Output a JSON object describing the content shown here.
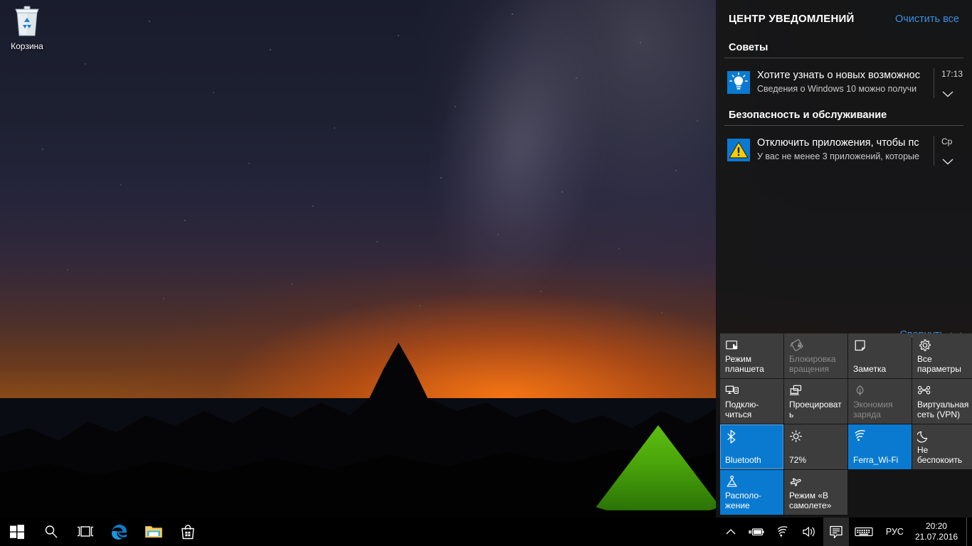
{
  "desktop": {
    "icon": {
      "name": "recycle-bin",
      "label": "Корзина"
    }
  },
  "action_center": {
    "title": "ЦЕНТР УВЕДОМЛЕНИЙ",
    "clear_all": "Очистить все",
    "collapse": "Свернуть",
    "accent_color": "#0a7ad1",
    "link_color": "#3b8ee0",
    "sections": [
      {
        "title": "Советы",
        "notifications": [
          {
            "icon": "lightbulb-icon",
            "icon_color": "#0a7ad1",
            "title": "Хотите узнать о новых возможнос",
            "subtitle": "Сведения о Windows 10 можно получи",
            "time": "17:13"
          }
        ]
      },
      {
        "title": "Безопасность и обслуживание",
        "notifications": [
          {
            "icon": "warning-icon",
            "icon_color": "#0a7ad1",
            "title": "Отключить приложения, чтобы пс",
            "subtitle": "У вас не менее 3 приложений, которые",
            "time": "Ср"
          }
        ]
      }
    ],
    "tiles": [
      {
        "icon": "tablet-mode-icon",
        "label": "Режим планшета",
        "state": "off"
      },
      {
        "icon": "rotation-lock-icon",
        "label": "Блокировка вращения",
        "state": "disabled"
      },
      {
        "icon": "note-icon",
        "label": "Заметка",
        "state": "off"
      },
      {
        "icon": "gear-icon",
        "label": "Все параметры",
        "state": "off"
      },
      {
        "icon": "connect-icon",
        "label": "Подклю-читься",
        "state": "off"
      },
      {
        "icon": "project-icon",
        "label": "Проецировать",
        "state": "off"
      },
      {
        "icon": "battery-saver-icon",
        "label": "Экономия заряда",
        "state": "disabled"
      },
      {
        "icon": "vpn-icon",
        "label": "Виртуальная сеть (VPN)",
        "state": "off"
      },
      {
        "icon": "bluetooth-icon",
        "label": "Bluetooth",
        "state": "on-focused"
      },
      {
        "icon": "brightness-icon",
        "label": "72%",
        "state": "off"
      },
      {
        "icon": "wifi-icon",
        "label": "Ferra_Wi-Fi",
        "state": "on"
      },
      {
        "icon": "moon-icon",
        "label": "Не беспокоить",
        "state": "off"
      },
      {
        "icon": "location-icon",
        "label": "Располо-жение",
        "state": "on"
      },
      {
        "icon": "airplane-icon",
        "label": "Режим «В самолете»",
        "state": "off"
      }
    ]
  },
  "taskbar": {
    "buttons": [
      {
        "icon": "windows-start-icon",
        "name": "start-button"
      },
      {
        "icon": "search-icon",
        "name": "search-button"
      },
      {
        "icon": "task-view-icon",
        "name": "task-view-button"
      },
      {
        "icon": "edge-icon",
        "name": "edge-button"
      },
      {
        "icon": "file-explorer-icon",
        "name": "file-explorer-button"
      },
      {
        "icon": "store-icon",
        "name": "store-button"
      }
    ],
    "tray": [
      {
        "icon": "chevron-up-icon",
        "name": "show-hidden-icons-button"
      },
      {
        "icon": "battery-charging-icon",
        "name": "battery-button"
      },
      {
        "icon": "wifi-icon",
        "name": "network-button"
      },
      {
        "icon": "volume-icon",
        "name": "volume-button"
      },
      {
        "icon": "action-center-icon",
        "name": "action-center-button",
        "active": true
      },
      {
        "icon": "keyboard-icon",
        "name": "touch-keyboard-button"
      }
    ],
    "language": "РУС",
    "clock": {
      "time": "20:20",
      "date": "21.07.2016"
    }
  }
}
